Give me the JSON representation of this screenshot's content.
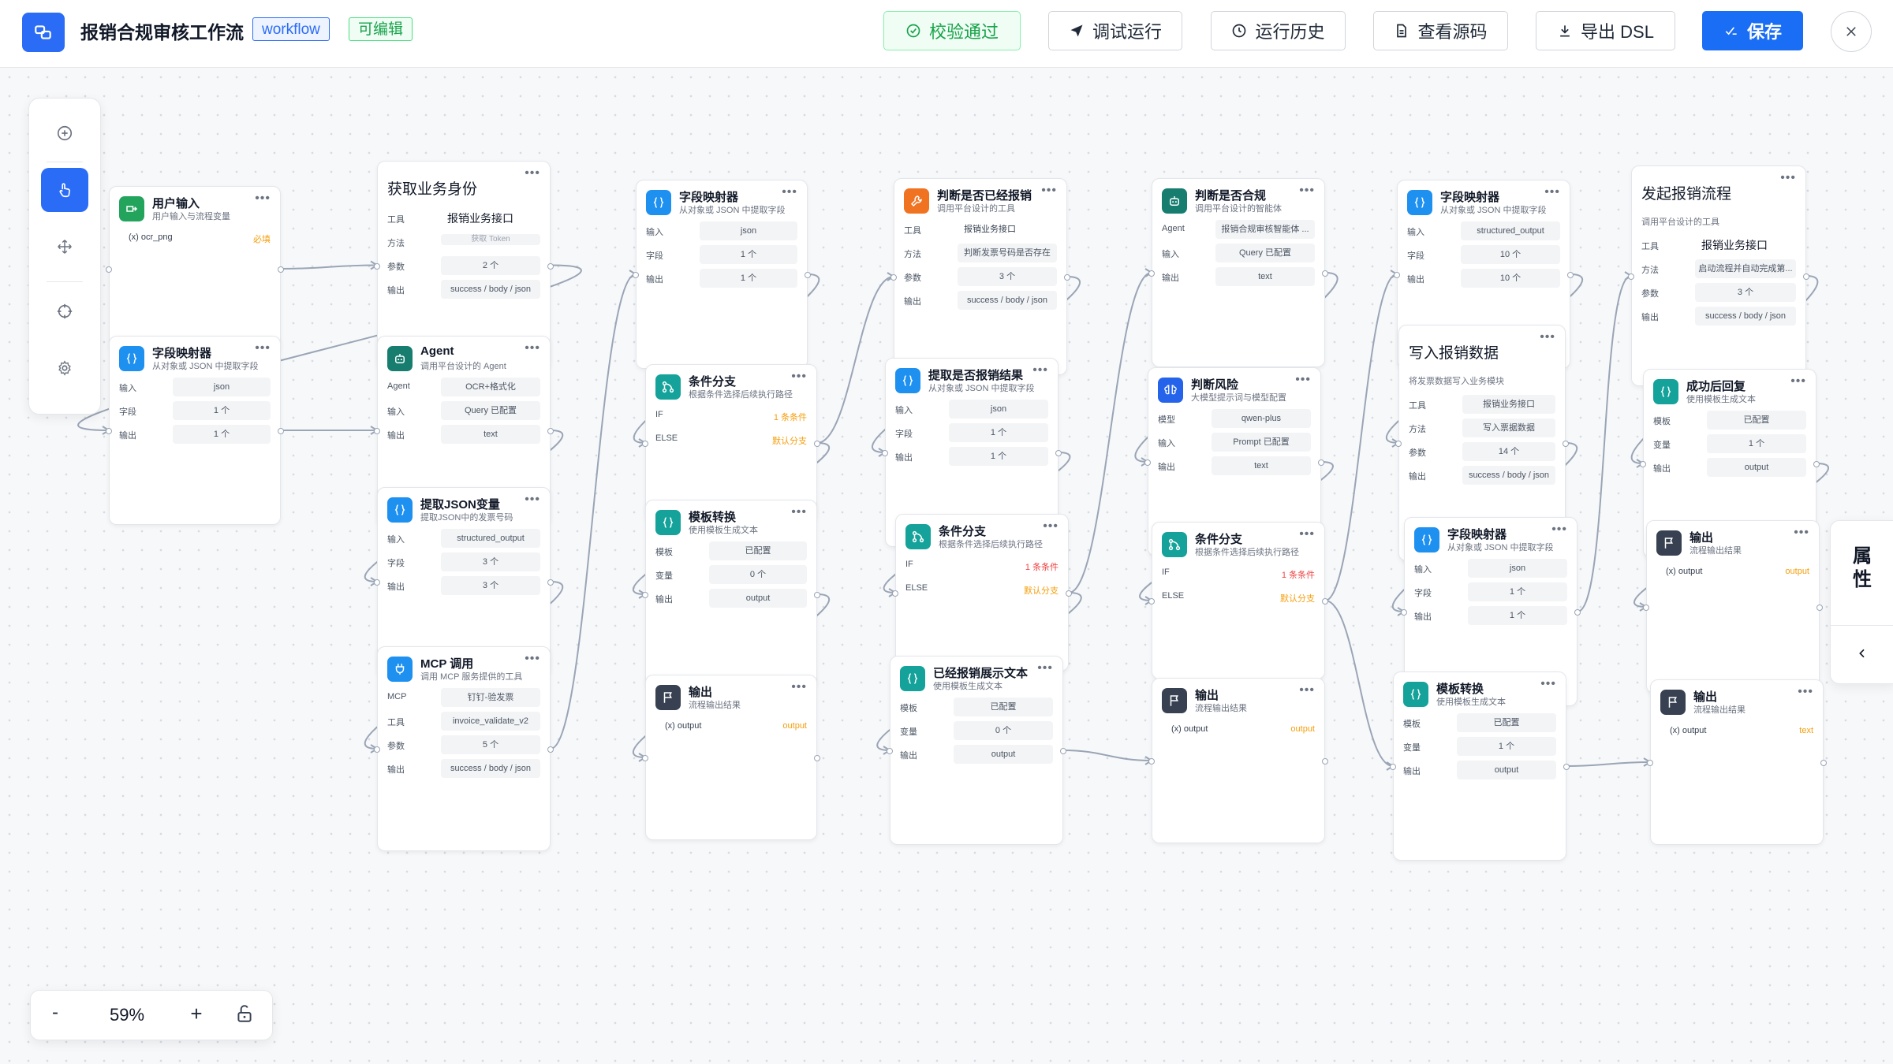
{
  "header": {
    "title": "报销合规审核工作流",
    "tag_type": "workflow",
    "tag_status": "可编辑",
    "validate_label": "校验通过",
    "debug_label": "调试运行",
    "history_label": "运行历史",
    "source_label": "查看源码",
    "export_label": "导出 DSL",
    "save_label": "保存"
  },
  "zoom": {
    "level": "59%",
    "minus": "-",
    "plus": "+"
  },
  "props": {
    "label": "属\n性"
  },
  "nodes": [
    {
      "id": "n1",
      "title": "用户输入",
      "sub": "用户输入与流程变量",
      "icon": "input",
      "color": "c-green",
      "rows": [
        {
          "val": "(x) ocr_png",
          "style": "plain",
          "tag": "必填",
          "tagstyle": ""
        }
      ]
    },
    {
      "id": "n2",
      "title": "获取业务身份",
      "big": true,
      "rows": [
        {
          "label": "工具",
          "val": "报销业务接口",
          "style": "bare bold left"
        },
        {
          "label": "方法",
          "val": "获取 Token",
          "style": "faded"
        },
        {
          "label": "参数",
          "val": "2 个"
        },
        {
          "label": "输出",
          "val": "success / body / json"
        }
      ]
    },
    {
      "id": "n3",
      "title": "字段映射器",
      "sub": "从对象或 JSON 中提取字段",
      "icon": "brace",
      "color": "c-blue",
      "rows": [
        {
          "label": "输入",
          "val": "json"
        },
        {
          "label": "字段",
          "val": "1 个"
        },
        {
          "label": "输出",
          "val": "1 个"
        }
      ]
    },
    {
      "id": "n4",
      "title": "Agent",
      "sub": "调用平台设计的 Agent",
      "icon": "bot",
      "color": "c-dteal",
      "rows": [
        {
          "label": "Agent",
          "val": "OCR+格式化"
        },
        {
          "label": "输入",
          "val": "Query 已配置"
        },
        {
          "label": "输出",
          "val": "text"
        }
      ]
    },
    {
      "id": "n5",
      "title": "提取JSON变量",
      "sub": "提取JSON中的发票号码",
      "icon": "brace",
      "color": "c-blue",
      "rows": [
        {
          "label": "输入",
          "val": "structured_output"
        },
        {
          "label": "字段",
          "val": "3 个"
        },
        {
          "label": "输出",
          "val": "3 个"
        }
      ]
    },
    {
      "id": "n6",
      "title": "MCP 调用",
      "sub": "调用 MCP 服务提供的工具",
      "icon": "plug",
      "color": "c-blue",
      "rows": [
        {
          "label": "MCP",
          "val": "钉钉-验发票"
        },
        {
          "label": "工具",
          "val": "invoice_validate_v2"
        },
        {
          "label": "参数",
          "val": "5 个"
        },
        {
          "label": "输出",
          "val": "success / body / json"
        }
      ]
    },
    {
      "id": "n7",
      "title": "字段映射器",
      "sub": "从对象或 JSON 中提取字段",
      "icon": "brace",
      "color": "c-blue",
      "rows": [
        {
          "label": "输入",
          "val": "json"
        },
        {
          "label": "字段",
          "val": "1 个"
        },
        {
          "label": "输出",
          "val": "1 个"
        }
      ]
    },
    {
      "id": "n8",
      "title": "条件分支",
      "sub": "根据条件选择后续执行路径",
      "icon": "branch",
      "color": "c-teal",
      "rows": [
        {
          "label": "IF",
          "val": "",
          "style": "bare",
          "tag": "1 条条件"
        },
        {
          "label": "ELSE",
          "val": "",
          "style": "bare",
          "tag": "默认分支"
        }
      ]
    },
    {
      "id": "n9",
      "title": "模板转换",
      "sub": "使用模板生成文本",
      "icon": "brace",
      "color": "c-teal",
      "rows": [
        {
          "label": "模板",
          "val": "已配置"
        },
        {
          "label": "变量",
          "val": "0 个"
        },
        {
          "label": "输出",
          "val": "output"
        }
      ]
    },
    {
      "id": "n10",
      "title": "输出",
      "sub": "流程输出结果",
      "icon": "flag",
      "color": "c-dark",
      "rows": [
        {
          "val": "(x) output",
          "style": "plain",
          "tag": "output"
        }
      ]
    },
    {
      "id": "n11",
      "title": "判断是否已经报销",
      "sub": "调用平台设计的工具",
      "icon": "tool",
      "color": "c-orange",
      "rows": [
        {
          "label": "工具",
          "val": "报销业务接口",
          "style": "bare left"
        },
        {
          "label": "方法",
          "val": "判断发票号码是否存在"
        },
        {
          "label": "参数",
          "val": "3 个"
        },
        {
          "label": "输出",
          "val": "success / body / json"
        }
      ]
    },
    {
      "id": "n12",
      "title": "提取是否报销结果",
      "sub": "从对象或 JSON 中提取字段",
      "icon": "brace",
      "color": "c-blue",
      "rows": [
        {
          "label": "输入",
          "val": "json"
        },
        {
          "label": "字段",
          "val": "1 个"
        },
        {
          "label": "输出",
          "val": "1 个"
        }
      ]
    },
    {
      "id": "n13",
      "title": "条件分支",
      "sub": "根据条件选择后续执行路径",
      "icon": "branch",
      "color": "c-teal",
      "rows": [
        {
          "label": "IF",
          "val": "",
          "style": "bare",
          "tag": "1 条条件",
          "tagstyle": "red"
        },
        {
          "label": "ELSE",
          "val": "",
          "style": "bare",
          "tag": "默认分支"
        }
      ]
    },
    {
      "id": "n14",
      "title": "已经报销展示文本",
      "sub": "使用模板生成文本",
      "icon": "brace",
      "color": "c-teal",
      "rows": [
        {
          "label": "模板",
          "val": "已配置"
        },
        {
          "label": "变量",
          "val": "0 个"
        },
        {
          "label": "输出",
          "val": "output"
        }
      ]
    },
    {
      "id": "n15",
      "title": "判断是否合规",
      "sub": "调用平台设计的智能体",
      "icon": "bot",
      "color": "c-dteal",
      "rows": [
        {
          "label": "Agent",
          "val": "报销合规审核智能体 ..."
        },
        {
          "label": "输入",
          "val": "Query 已配置"
        },
        {
          "label": "输出",
          "val": "text"
        }
      ]
    },
    {
      "id": "n16",
      "title": "判断风险",
      "sub": "大模型提示词与模型配置",
      "icon": "brain",
      "color": "c-indigo",
      "rows": [
        {
          "label": "模型",
          "val": "qwen-plus"
        },
        {
          "label": "输入",
          "val": "Prompt 已配置"
        },
        {
          "label": "输出",
          "val": "text"
        }
      ]
    },
    {
      "id": "n17",
      "title": "条件分支",
      "sub": "根据条件选择后续执行路径",
      "icon": "branch",
      "color": "c-teal",
      "rows": [
        {
          "label": "IF",
          "val": "",
          "style": "bare",
          "tag": "1 条条件",
          "tagstyle": "red"
        },
        {
          "label": "ELSE",
          "val": "",
          "style": "bare",
          "tag": "默认分支"
        }
      ]
    },
    {
      "id": "n18",
      "title": "输出",
      "sub": "流程输出结果",
      "icon": "flag",
      "color": "c-dark",
      "rows": [
        {
          "val": "(x) output",
          "style": "plain",
          "tag": "output"
        }
      ]
    },
    {
      "id": "n19",
      "title": "字段映射器",
      "sub": "从对象或 JSON 中提取字段",
      "icon": "brace",
      "color": "c-blue",
      "rows": [
        {
          "label": "输入",
          "val": "structured_output"
        },
        {
          "label": "字段",
          "val": "10 个"
        },
        {
          "label": "输出",
          "val": "10 个"
        }
      ]
    },
    {
      "id": "n20",
      "title": "写入报销数据",
      "big": true,
      "sub2": "将发票数据写入业务模块",
      "icon": "tool",
      "color": "c-orange",
      "rows": [
        {
          "label": "工具",
          "val": "报销业务接口"
        },
        {
          "label": "方法",
          "val": "写入票据数据"
        },
        {
          "label": "参数",
          "val": "14 个"
        },
        {
          "label": "输出",
          "val": "success / body / json"
        }
      ]
    },
    {
      "id": "n21",
      "title": "字段映射器",
      "sub": "从对象或 JSON 中提取字段",
      "icon": "brace",
      "color": "c-blue",
      "rows": [
        {
          "label": "输入",
          "val": "json"
        },
        {
          "label": "字段",
          "val": "1 个"
        },
        {
          "label": "输出",
          "val": "1 个"
        }
      ]
    },
    {
      "id": "n22",
      "title": "模板转换",
      "sub": "使用模板生成文本",
      "icon": "brace",
      "color": "c-teal",
      "rows": [
        {
          "label": "模板",
          "val": "已配置"
        },
        {
          "label": "变量",
          "val": "1 个"
        },
        {
          "label": "输出",
          "val": "output"
        }
      ]
    },
    {
      "id": "n23",
      "title": "发起报销流程",
      "big": true,
      "sub2": "调用平台设计的工具",
      "icon": "tool",
      "color": "c-orange",
      "rows": [
        {
          "label": "工具",
          "val": "报销业务接口",
          "style": "bare bold left"
        },
        {
          "label": "方法",
          "val": "启动流程并自动完成第..."
        },
        {
          "label": "参数",
          "val": "3 个"
        },
        {
          "label": "输出",
          "val": "success / body / json"
        }
      ]
    },
    {
      "id": "n24",
      "title": "成功后回复",
      "sub": "使用模板生成文本",
      "icon": "brace",
      "color": "c-teal",
      "rows": [
        {
          "label": "模板",
          "val": "已配置"
        },
        {
          "label": "变量",
          "val": "1 个"
        },
        {
          "label": "输出",
          "val": "output"
        }
      ]
    },
    {
      "id": "n25",
      "title": "输出",
      "sub": "流程输出结果",
      "icon": "flag",
      "color": "c-dark",
      "rows": [
        {
          "val": "(x) output",
          "style": "plain",
          "tag": "output"
        }
      ]
    },
    {
      "id": "n26",
      "title": "输出",
      "sub": "流程输出结果",
      "icon": "flag",
      "color": "c-dark",
      "rows": [
        {
          "val": "(x) output",
          "style": "plain",
          "tag": "text"
        }
      ]
    }
  ]
}
